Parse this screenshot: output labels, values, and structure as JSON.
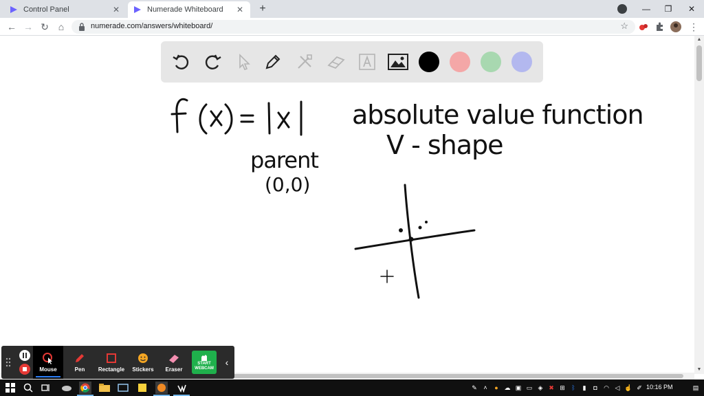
{
  "browser": {
    "tabs": [
      {
        "title": "Control Panel",
        "active": false
      },
      {
        "title": "Numerade Whiteboard",
        "active": true
      }
    ],
    "address": {
      "url": "numerade.com/answers/whiteboard/"
    }
  },
  "whiteboard": {
    "tools": [
      "undo-icon",
      "redo-icon",
      "pointer-icon",
      "pen-icon",
      "tools-icon",
      "eraser-icon",
      "text-icon",
      "image-icon"
    ],
    "colors": [
      "#000000",
      "#f4a7a7",
      "#a8d8b0",
      "#b3b8ef"
    ],
    "handwriting": {
      "equation": "f(x) = |x|",
      "title": "absolute value function",
      "shape": "V - shape",
      "parent": "parent",
      "point": "(0,0)"
    }
  },
  "recorder": {
    "items": [
      {
        "label": "Mouse",
        "icon": "mouse-icon",
        "active": true
      },
      {
        "label": "Pen",
        "icon": "pen-icon",
        "active": false
      },
      {
        "label": "Rectangle",
        "icon": "rectangle-icon",
        "active": false
      },
      {
        "label": "Stickers",
        "icon": "sticker-icon",
        "active": false
      },
      {
        "label": "Eraser",
        "icon": "eraser-icon",
        "active": false
      }
    ],
    "webcam_label": "START WEBCAM"
  },
  "taskbar": {
    "clock": "10:16 PM"
  }
}
